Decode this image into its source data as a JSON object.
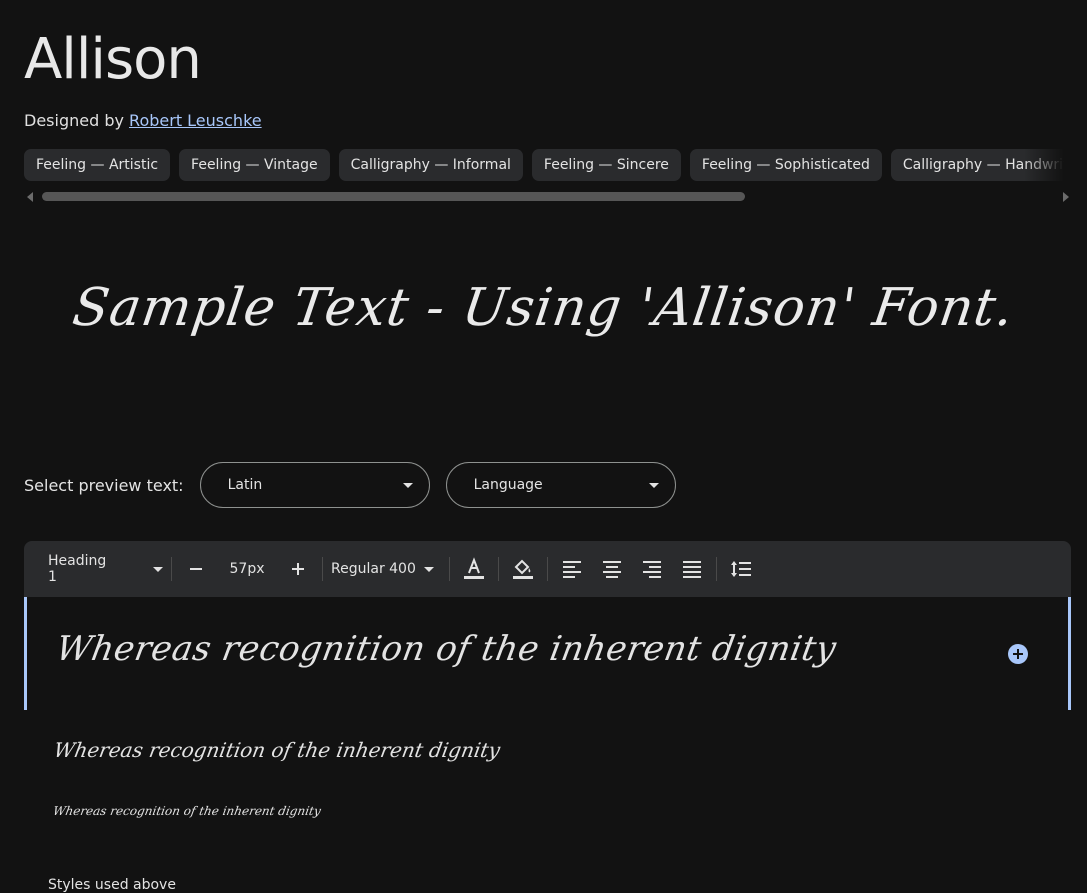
{
  "header": {
    "title": "Allison",
    "designed_by_prefix": "Designed by",
    "designer_name": "Robert Leuschke"
  },
  "tags": [
    {
      "label": "Feeling — Artistic"
    },
    {
      "label": "Feeling — Vintage"
    },
    {
      "label": "Calligraphy — Informal"
    },
    {
      "label": "Feeling — Sincere"
    },
    {
      "label": "Feeling — Sophisticated"
    },
    {
      "label": "Calligraphy — Handwritten"
    }
  ],
  "hero": {
    "sample_text": "Sample Text - Using 'Allison' Font."
  },
  "preview": {
    "label": "Select preview text:",
    "script_select": "Latin",
    "language_select": "Language"
  },
  "toolbar": {
    "style_select": "Heading 1",
    "size_value": "57px",
    "weight_select": "Regular 400",
    "colors": {
      "accent": "#a8c7fa",
      "background": "#121212",
      "toolbar_bg": "#2a2b2d"
    }
  },
  "editor": {
    "line1": "Whereas recognition of the inherent dignity",
    "line2": "Whereas recognition of the inherent dignity",
    "line3": "Whereas recognition of the inherent dignity"
  },
  "footer": {
    "styles_used": "Styles used above"
  }
}
